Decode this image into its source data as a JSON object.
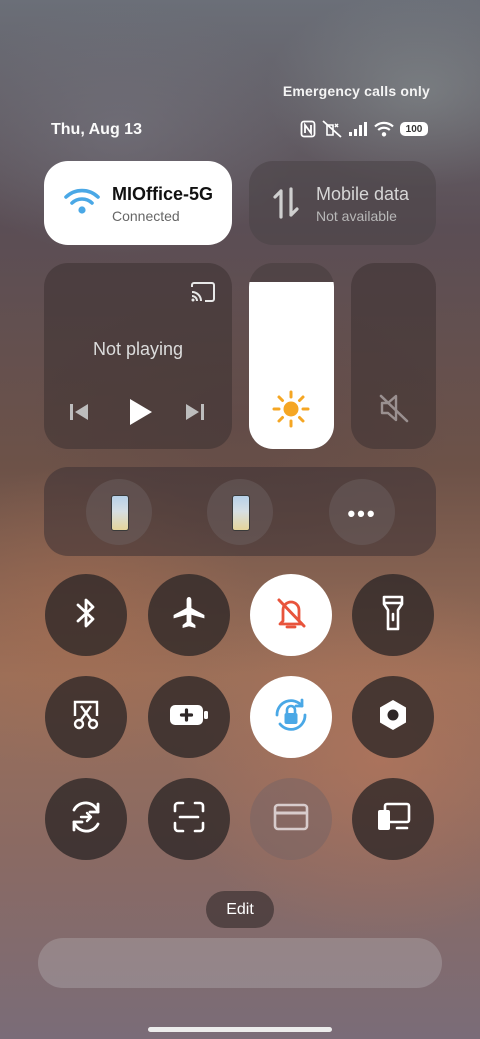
{
  "status_bar": {
    "carrier_text": "Emergency calls only",
    "date": "Thu, Aug 13",
    "battery_level": "100",
    "icons": [
      "nfc-icon",
      "silent-icon",
      "signal-icon",
      "wifi-icon",
      "battery-icon"
    ]
  },
  "wifi_tile": {
    "name": "MIOffice-5G",
    "status": "Connected",
    "active": true
  },
  "mobile_tile": {
    "name": "Mobile data",
    "status": "Not available",
    "active": false
  },
  "media": {
    "status": "Not playing"
  },
  "brightness": {
    "level": 0.9
  },
  "volume": {
    "muted": true
  },
  "devices": {
    "items": [
      "phone-device-1",
      "phone-device-2"
    ],
    "more_icon": "more-icon"
  },
  "toggles": [
    {
      "name": "bluetooth",
      "icon": "bluetooth-icon",
      "active": false
    },
    {
      "name": "airplane-mode",
      "icon": "airplane-icon",
      "active": false
    },
    {
      "name": "mute",
      "icon": "bell-off-icon",
      "active": true
    },
    {
      "name": "flashlight",
      "icon": "flashlight-icon",
      "active": false
    },
    {
      "name": "screenshot",
      "icon": "scissors-icon",
      "active": false
    },
    {
      "name": "battery-saver",
      "icon": "battery-plus-icon",
      "active": false
    },
    {
      "name": "rotation-lock",
      "icon": "rotation-lock-icon",
      "active": true
    },
    {
      "name": "settings",
      "icon": "hexagon-icon",
      "active": false
    },
    {
      "name": "sync",
      "icon": "sync-icon",
      "active": false
    },
    {
      "name": "scanner",
      "icon": "scan-icon",
      "active": false
    },
    {
      "name": "wallet",
      "icon": "card-icon",
      "active": false,
      "dimmed": true
    },
    {
      "name": "cast-devices",
      "icon": "devices-icon",
      "active": false
    }
  ],
  "edit_label": "Edit",
  "colors": {
    "accent_blue": "#4aa8e6",
    "alert_red": "#e8543c"
  }
}
